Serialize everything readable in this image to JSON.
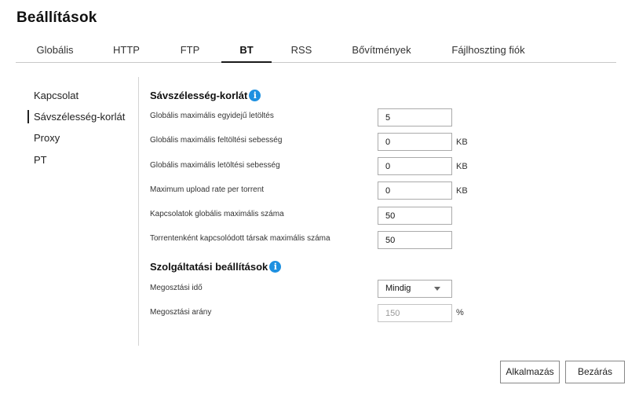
{
  "window": {
    "title": "Beállítások"
  },
  "tabs": [
    {
      "label": "Globális"
    },
    {
      "label": "HTTP"
    },
    {
      "label": "FTP"
    },
    {
      "label": "BT"
    },
    {
      "label": "RSS"
    },
    {
      "label": "Bővítmények"
    },
    {
      "label": "Fájlhoszting fiók"
    }
  ],
  "active_tab": "BT",
  "sidebar": {
    "items": [
      {
        "label": "Kapcsolat"
      },
      {
        "label": "Sávszélesség-korlát"
      },
      {
        "label": "Proxy"
      },
      {
        "label": "PT"
      }
    ],
    "active": "Sávszélesség-korlát"
  },
  "bandwidth": {
    "title": "Sávszélesség-korlát",
    "info_icon": "info-icon",
    "rows": [
      {
        "label": "Globális maximális egyidejű letöltés",
        "value": "5",
        "unit": ""
      },
      {
        "label": "Globális maximális feltöltési sebesség",
        "value": "0",
        "unit": "KB"
      },
      {
        "label": "Globális maximális letöltési sebesség",
        "value": "0",
        "unit": "KB"
      },
      {
        "label": "Maximum upload rate per torrent",
        "value": "0",
        "unit": "KB"
      },
      {
        "label": "Kapcsolatok globális maximális száma",
        "value": "50",
        "unit": ""
      },
      {
        "label": "Torrentenként kapcsolódott társak maximális száma",
        "value": "50",
        "unit": ""
      }
    ]
  },
  "service": {
    "title": "Szolgáltatási beállítások",
    "info_icon": "info-icon",
    "share_time": {
      "label": "Megosztási idő",
      "selected": "Mindig"
    },
    "share_ratio": {
      "label": "Megosztási arány",
      "value": "150",
      "unit": "%"
    }
  },
  "buttons": {
    "apply": "Alkalmazás",
    "close": "Bezárás"
  },
  "colors": {
    "accent": "#1e90e0",
    "active_tab_underline": "#1a1a1a"
  }
}
